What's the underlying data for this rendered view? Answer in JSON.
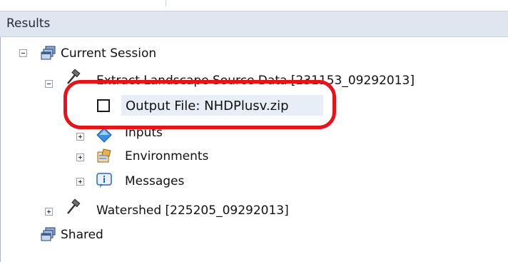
{
  "panel": {
    "title": "Results"
  },
  "tree": {
    "current_session": {
      "label": "Current Session",
      "icon": "session-stack-icon"
    },
    "tool_run": {
      "label": "Extract Landscape Source Data [231153_09292013]",
      "icon": "hammer-icon"
    },
    "output_file": {
      "label": "Output File: NHDPlusv.zip",
      "icon": "checkbox-icon"
    },
    "inputs": {
      "label": "Inputs",
      "icon": "diamond-icon"
    },
    "environments": {
      "label": "Environments",
      "icon": "environment-icon"
    },
    "messages": {
      "label": "Messages",
      "icon": "info-icon"
    },
    "watershed": {
      "label": "Watershed [225205_09292013]",
      "icon": "hammer-icon"
    },
    "shared": {
      "label": "Shared",
      "icon": "session-stack-icon"
    }
  },
  "annotation": {
    "color": "#e3141b"
  }
}
